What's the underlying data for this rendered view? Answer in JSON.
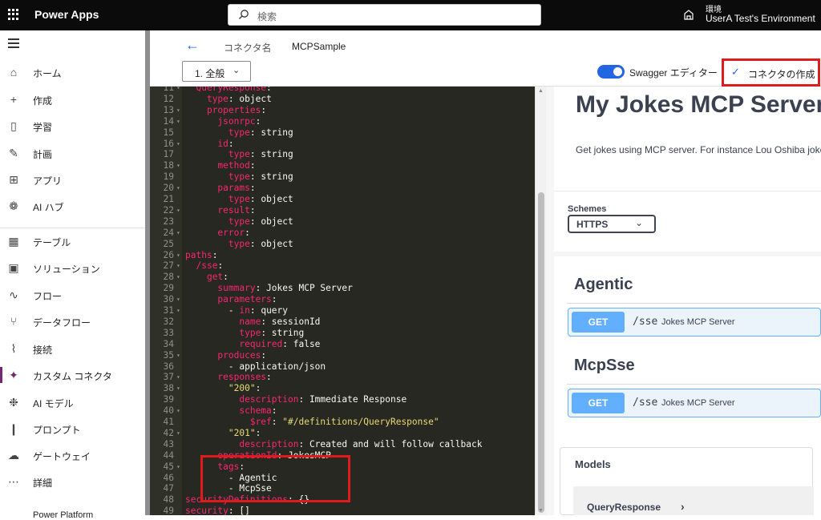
{
  "topbar": {
    "app_title": "Power Apps",
    "search_placeholder": "検索",
    "env_label": "環境",
    "env_name": "UserA Test's Environment"
  },
  "sidebar": {
    "items": [
      {
        "label": "ホーム",
        "icon": "home-icon"
      },
      {
        "label": "作成",
        "icon": "plus-icon"
      },
      {
        "label": "学習",
        "icon": "book-icon"
      },
      {
        "label": "計画",
        "icon": "plan-icon"
      },
      {
        "label": "アプリ",
        "icon": "apps-icon"
      },
      {
        "label": "AI ハブ",
        "icon": "ai-hub-icon"
      },
      {
        "label": "テーブル",
        "icon": "table-icon"
      },
      {
        "label": "ソリューション",
        "icon": "solution-icon"
      },
      {
        "label": "フロー",
        "icon": "flow-icon"
      },
      {
        "label": "データフロー",
        "icon": "dataflow-icon"
      },
      {
        "label": "接続",
        "icon": "plug-icon"
      },
      {
        "label": "カスタム コネクタ",
        "icon": "custom-connector-icon"
      },
      {
        "label": "AI モデル",
        "icon": "ai-model-icon"
      },
      {
        "label": "プロンプト",
        "icon": "prompt-icon"
      },
      {
        "label": "ゲートウェイ",
        "icon": "gateway-icon"
      },
      {
        "label": "詳細",
        "icon": "more-icon"
      }
    ],
    "footer_partial": "Power Platform"
  },
  "header": {
    "connector_label": "コネクタ名",
    "connector_name": "MCPSample"
  },
  "toolbar": {
    "step_label": "1. 全般",
    "swagger_label": "Swagger エディター",
    "swagger_on": true,
    "create_label": "コネクタの作成"
  },
  "editor": {
    "lines": [
      {
        "n": "11",
        "fold": true,
        "code": "  QueryResponse:"
      },
      {
        "n": "12",
        "fold": false,
        "code": "    type: object"
      },
      {
        "n": "13",
        "fold": true,
        "code": "    properties:"
      },
      {
        "n": "14",
        "fold": true,
        "code": "      jsonrpc:"
      },
      {
        "n": "15",
        "fold": false,
        "code": "        type: string"
      },
      {
        "n": "16",
        "fold": true,
        "code": "      id:"
      },
      {
        "n": "17",
        "fold": false,
        "code": "        type: string"
      },
      {
        "n": "18",
        "fold": true,
        "code": "      method:"
      },
      {
        "n": "19",
        "fold": false,
        "code": "        type: string"
      },
      {
        "n": "20",
        "fold": true,
        "code": "      params:"
      },
      {
        "n": "21",
        "fold": false,
        "code": "        type: object"
      },
      {
        "n": "22",
        "fold": true,
        "code": "      result:"
      },
      {
        "n": "23",
        "fold": false,
        "code": "        type: object"
      },
      {
        "n": "24",
        "fold": true,
        "code": "      error:"
      },
      {
        "n": "25",
        "fold": false,
        "code": "        type: object"
      },
      {
        "n": "26",
        "fold": true,
        "code": "paths:"
      },
      {
        "n": "27",
        "fold": true,
        "code": "  /sse:"
      },
      {
        "n": "28",
        "fold": true,
        "code": "    get:"
      },
      {
        "n": "29",
        "fold": false,
        "code": "      summary: Jokes MCP Server"
      },
      {
        "n": "30",
        "fold": true,
        "code": "      parameters:"
      },
      {
        "n": "31",
        "fold": true,
        "code": "        - in: query"
      },
      {
        "n": "32",
        "fold": false,
        "code": "          name: sessionId"
      },
      {
        "n": "33",
        "fold": false,
        "code": "          type: string"
      },
      {
        "n": "34",
        "fold": false,
        "code": "          required: false"
      },
      {
        "n": "35",
        "fold": true,
        "code": "      produces:"
      },
      {
        "n": "36",
        "fold": false,
        "code": "        - application/json"
      },
      {
        "n": "37",
        "fold": true,
        "code": "      responses:"
      },
      {
        "n": "38",
        "fold": true,
        "code": "        \"200\":"
      },
      {
        "n": "39",
        "fold": false,
        "code": "          description: Immediate Response"
      },
      {
        "n": "40",
        "fold": true,
        "code": "          schema:"
      },
      {
        "n": "41",
        "fold": false,
        "code": "            $ref: \"#/definitions/QueryResponse\""
      },
      {
        "n": "42",
        "fold": true,
        "code": "        \"201\":"
      },
      {
        "n": "43",
        "fold": false,
        "code": "          description: Created and will follow callback"
      },
      {
        "n": "44",
        "fold": false,
        "code": "      operationId: JokesMCP"
      },
      {
        "n": "45",
        "fold": true,
        "code": "      tags:"
      },
      {
        "n": "46",
        "fold": false,
        "code": "        - Agentic"
      },
      {
        "n": "47",
        "fold": false,
        "code": "        - McpSse"
      },
      {
        "n": "48",
        "fold": false,
        "code": "securityDefinitions: {}"
      },
      {
        "n": "49",
        "fold": false,
        "code": "security: []"
      }
    ]
  },
  "preview": {
    "title": "My Jokes MCP Server",
    "description": "Get jokes using MCP server. For instance Lou Oshiba jokes.",
    "schemes_label": "Schemes",
    "scheme_value": "HTTPS",
    "tags": [
      {
        "name": "Agentic",
        "method": "GET",
        "path": "/sse",
        "summary": "Jokes MCP Server"
      },
      {
        "name": "McpSse",
        "method": "GET",
        "path": "/sse",
        "summary": "Jokes MCP Server"
      }
    ],
    "models_label": "Models",
    "model_name": "QueryResponse"
  },
  "colors": {
    "accent": "#2266e3",
    "highlight_box": "#e01b1b",
    "get_method": "#61affe",
    "active_nav": "#742774"
  }
}
